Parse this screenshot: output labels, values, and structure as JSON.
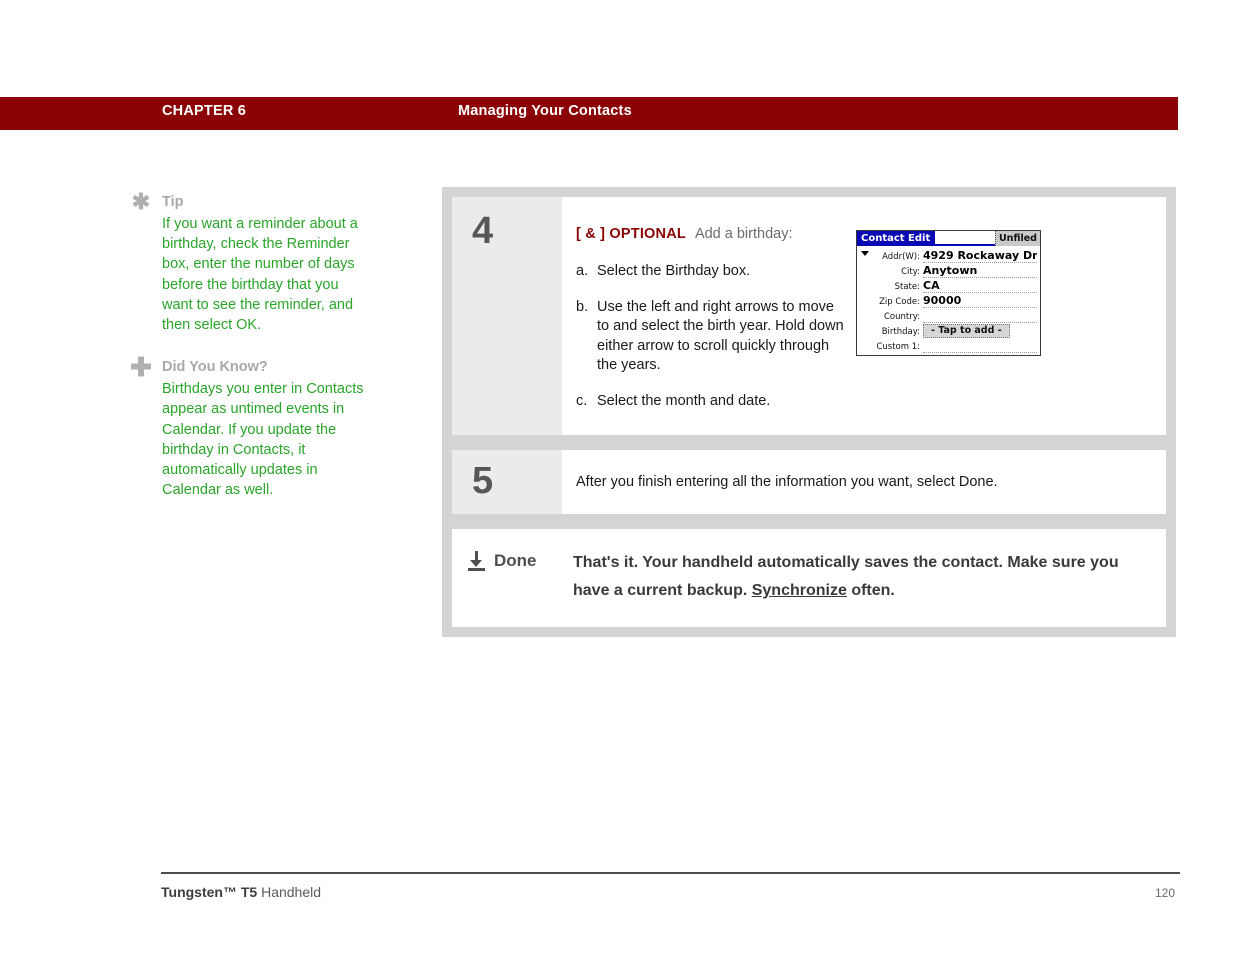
{
  "header": {
    "chapter": "CHAPTER 6",
    "title": "Managing Your Contacts",
    "bar_color": "#8b0304"
  },
  "sidebar": {
    "notes": [
      {
        "icon": "asterisk-icon",
        "glyph": "✱",
        "heading": "Tip",
        "text": "If you want a reminder about a birthday, check the Reminder box, enter the number of days before the birthday that you want to see the reminder, and then select OK."
      },
      {
        "icon": "plus-icon",
        "glyph": "✚",
        "heading": "Did You Know?",
        "text": "Birthdays you enter in Contacts appear as untimed events in Calendar. If you update the birthday in Contacts, it automatically updates in Calendar as well."
      }
    ],
    "note_text_color": "#2aa52a",
    "note_heading_color": "#a8a8a8"
  },
  "steps": [
    {
      "number": "4",
      "optional_tag": "[ & ]  OPTIONAL",
      "optional_rest": "Add a birthday:",
      "substeps": [
        {
          "marker": "a.",
          "text": "Select the Birthday box."
        },
        {
          "marker": "b.",
          "text": "Use the left and right arrows to move to and select the birth year. Hold down either arrow to scroll quickly through the years."
        },
        {
          "marker": "c.",
          "text": "Select the month and date."
        }
      ]
    },
    {
      "number": "5",
      "text": "After you finish entering all the information you want, select Done."
    }
  ],
  "device": {
    "title": "Contact Edit",
    "category": "Unfiled",
    "title_bg": "#0a0ab4",
    "rows": [
      {
        "label": "Addr(W):",
        "value": "4929 Rockaway Dr."
      },
      {
        "label": "City:",
        "value": "Anytown"
      },
      {
        "label": "State:",
        "value": "CA"
      },
      {
        "label": "Zip Code:",
        "value": "90000"
      },
      {
        "label": "Country:",
        "value": ""
      },
      {
        "label": "Birthday:",
        "value": "- Tap to add -",
        "is_button": true
      },
      {
        "label": "Custom 1:",
        "value": ""
      }
    ]
  },
  "done": {
    "icon": "download-arrow-icon",
    "label": "Done",
    "text_part1": "That's it. Your handheld automatically saves the contact. Make sure you have a current backup. ",
    "link": "Synchronize",
    "text_part2": " often."
  },
  "footer": {
    "product_bold": "Tungsten™ T5",
    "product_rest": " Handheld",
    "page_number": "120"
  }
}
